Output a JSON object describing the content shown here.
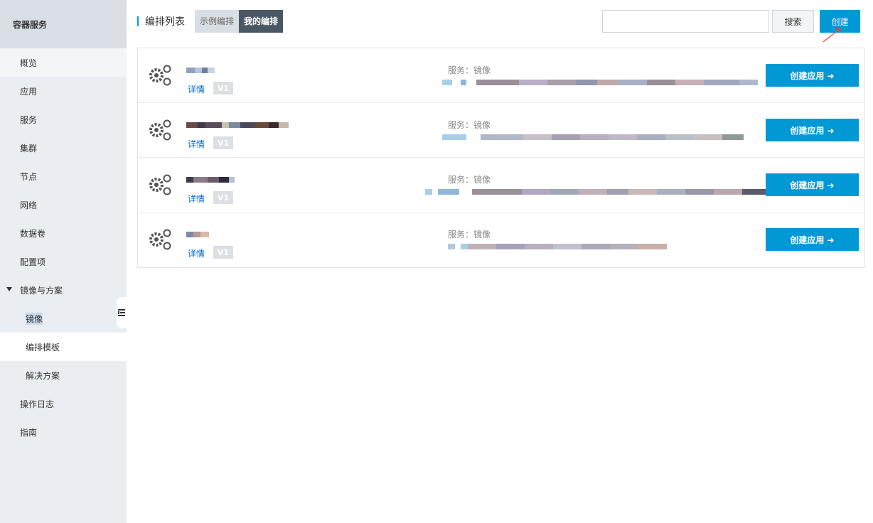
{
  "sidebar": {
    "title": "容器服务",
    "items": [
      {
        "label": "概览"
      },
      {
        "label": "应用"
      },
      {
        "label": "服务"
      },
      {
        "label": "集群"
      },
      {
        "label": "节点"
      },
      {
        "label": "网络"
      },
      {
        "label": "数据卷"
      },
      {
        "label": "配置项"
      },
      {
        "label": "镜像与方案"
      },
      {
        "label": "镜像"
      },
      {
        "label": "编排模板"
      },
      {
        "label": "解决方案"
      },
      {
        "label": "操作日志"
      },
      {
        "label": "指南"
      }
    ]
  },
  "header": {
    "title": "编排列表",
    "tabs": [
      {
        "label": "示例编排"
      },
      {
        "label": "我的编排"
      }
    ],
    "search_value": "",
    "search_label": "搜索",
    "create_label": "创建"
  },
  "rows": [
    {
      "detail": "详情",
      "version": "V1",
      "service_label": "服务：镜像",
      "action": "创建应用 ➜"
    },
    {
      "detail": "详情",
      "version": "V1",
      "service_label": "服务：镜像",
      "action": "创建应用 ➜"
    },
    {
      "detail": "详情",
      "version": "V1",
      "service_label": "服务：镜像",
      "action": "创建应用 ➜"
    },
    {
      "detail": "详情",
      "version": "V1",
      "service_label": "服务：镜像",
      "action": "创建应用 ➜"
    }
  ],
  "colors": {
    "accent": "#0099d6",
    "active_tab": "#4a5865",
    "link": "#0066cc"
  }
}
